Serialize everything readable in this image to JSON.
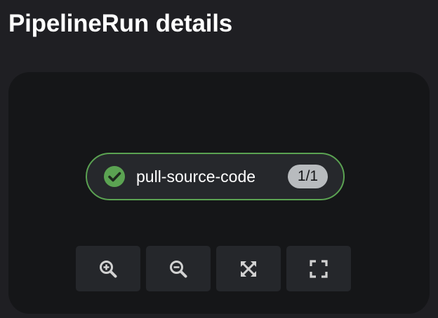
{
  "page": {
    "title": "PipelineRun details"
  },
  "topology": {
    "task_node": {
      "name": "pull-source-code",
      "badge": "1/1",
      "status": "succeeded",
      "status_icon": "check-circle-icon",
      "border_color": "#5ba352",
      "status_color": "#5ba352"
    },
    "controls": [
      {
        "name": "zoom-in",
        "icon": "zoom-in-icon"
      },
      {
        "name": "zoom-out",
        "icon": "zoom-out-icon"
      },
      {
        "name": "fit-to-screen",
        "icon": "expand-arrows-icon"
      },
      {
        "name": "reset-view",
        "icon": "fullscreen-corners-icon"
      }
    ]
  },
  "colors": {
    "background": "#1f1f23",
    "panel": "#151618",
    "node_background": "#26282c",
    "button_background": "#25272b",
    "icon": "#d2d2d2",
    "badge": "#b8bbbe"
  }
}
